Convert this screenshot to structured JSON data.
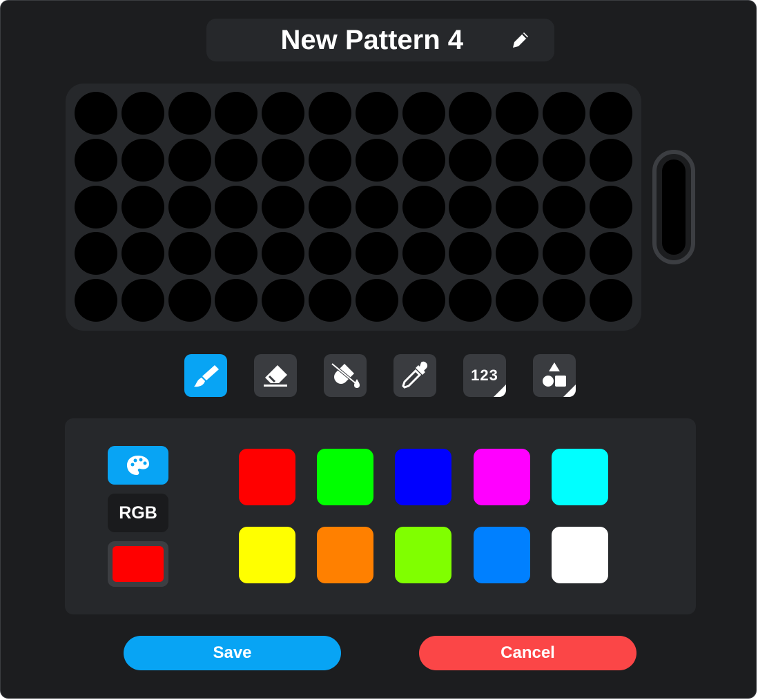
{
  "pattern": {
    "title": "New Pattern 4",
    "rows": 5,
    "cols": 12,
    "led_color": "#000000"
  },
  "tools": [
    {
      "name": "brush-tool",
      "icon": "brush-icon",
      "active": true
    },
    {
      "name": "eraser-tool",
      "icon": "eraser-icon",
      "active": false
    },
    {
      "name": "fill-tool",
      "icon": "paint-bucket-icon",
      "active": false
    },
    {
      "name": "eyedropper-tool",
      "icon": "eyedropper-icon",
      "active": false
    },
    {
      "name": "number-tool",
      "icon": "numbers-icon",
      "label": "123",
      "active": false
    },
    {
      "name": "shapes-tool",
      "icon": "shapes-icon",
      "active": false
    }
  ],
  "palette": {
    "mode_palette_icon": "palette-icon",
    "mode_rgb_label": "RGB",
    "current_color": "#ff0000",
    "swatches": [
      "#ff0000",
      "#00ff00",
      "#0000ff",
      "#ff00ff",
      "#00ffff",
      "#ffff00",
      "#ff8000",
      "#80ff00",
      "#0080ff",
      "#ffffff"
    ]
  },
  "actions": {
    "save_label": "Save",
    "cancel_label": "Cancel"
  },
  "colors": {
    "accent": "#08a4f4",
    "danger": "#fb4647"
  }
}
